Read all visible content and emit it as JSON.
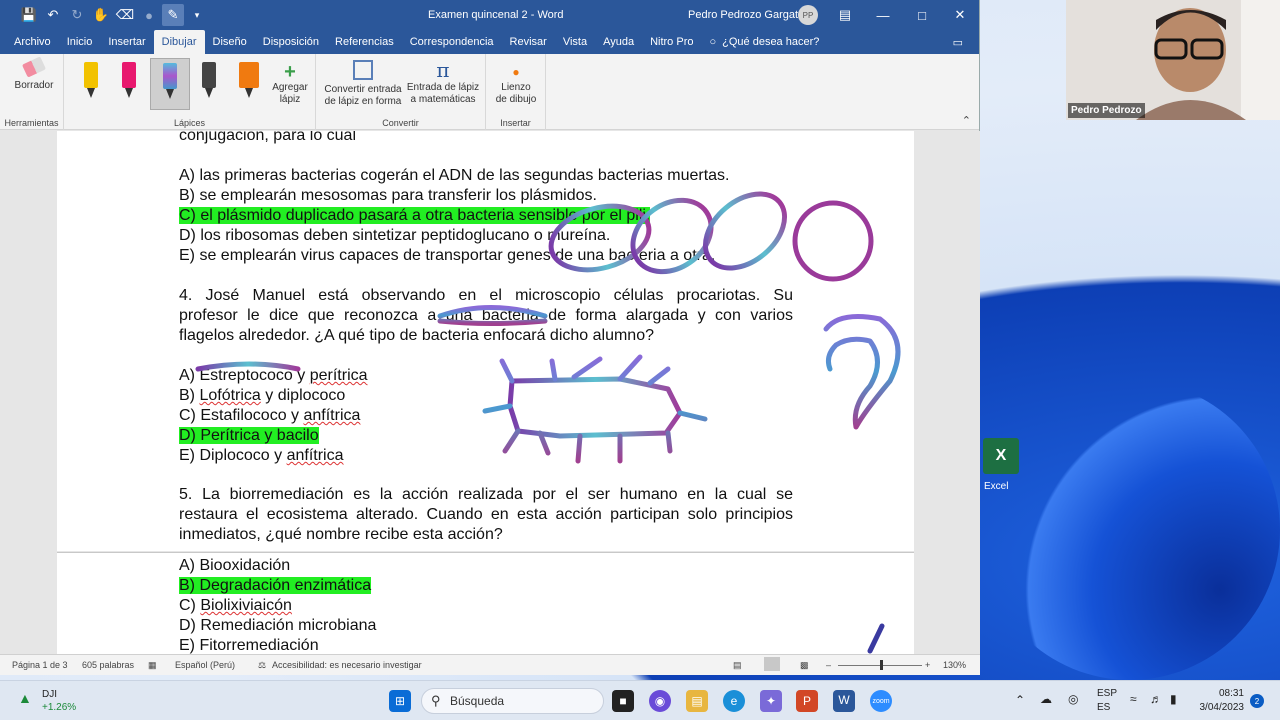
{
  "window": {
    "title": "Examen quincenal 2  -  Word",
    "user": "Pedro Pedrozo Gargate",
    "user_initials": "PP"
  },
  "menu": {
    "tabs": [
      "Archivo",
      "Inicio",
      "Insertar",
      "Dibujar",
      "Diseño",
      "Disposición",
      "Referencias",
      "Correspondencia",
      "Revisar",
      "Vista",
      "Ayuda",
      "Nitro Pro"
    ],
    "active": "Dibujar",
    "tell_me": "¿Qué desea hacer?"
  },
  "ribbon": {
    "eraser": "Borrador",
    "group_tools": "Herramientas",
    "add_pencil_1": "Agregar",
    "add_pencil_2": "lápiz",
    "group_pencils": "Lápices",
    "convert_1": "Convertir entrada",
    "convert_2": "de lápiz en forma",
    "math_1": "Entrada de lápiz",
    "math_2": "a matemáticas",
    "group_convert": "Convertir",
    "canvas_1": "Lienzo",
    "canvas_2": "de dibujo",
    "group_insert": "Insertar",
    "pen_colors": [
      "#f2c200",
      "#e8186e",
      "#6aa6d8",
      "#444444",
      "#f07a10"
    ]
  },
  "doc": {
    "l0": "conjugación, para lo cual",
    "q3a": "A) las primeras bacterias cogerán el ADN de las segundas bacterias muertas.",
    "q3b": "B) se emplearán mesosomas para transferir los plásmidos.",
    "q3c": "C) el plásmido duplicado pasará a otra bacteria sensible por el pili.",
    "q3d": "D) los ribosomas deben sintetizar peptidoglucano o mureína.",
    "q3e": "E) se emplearán virus capaces de transportar genes de una bacteria a otra.",
    "q4_l1": "4. José Manuel está observando en el microscopio células procariotas. Su",
    "q4_l2": "profesor le dice que reconozca a una bacteria de forma alargada y con varios",
    "q4_l3": "flagelos alrededor. ¿A qué tipo de bacteria enfocará dicho alumno?",
    "q4a_pre": "A) Estreptococo y ",
    "q4a_sq": "perítrica",
    "q4b_pre": "B) ",
    "q4b_sq": "Lofótrica",
    "q4b_post": " y diplococo",
    "q4c_pre": "C) Estafilococo y ",
    "q4c_sq": "anfítrica",
    "q4d": "D) Perítrica y bacilo",
    "q4e_pre": "E) Diplococo y ",
    "q4e_sq": "anfítrica",
    "q5_l1": "5. La biorremediación es la acción realizada por el ser humano en la cual se",
    "q5_l2": "restaura el ecosistema alterado. Cuando en esta acción participan solo principios",
    "q5_l3": "inmediatos, ¿qué nombre recibe esta acción?",
    "q5a": "A) Biooxidación",
    "q5b": "B) Degradación enzimática",
    "q5c_pre": "C) ",
    "q5c_sq": "Biolixiviaicón",
    "q5d": "D) Remediación microbiana",
    "q5e": "E) Fitorremediación"
  },
  "status": {
    "page": "Página 1 de 3",
    "words": "605 palabras",
    "language": "Español (Perú)",
    "accessibility": "Accesibilidad: es necesario investigar",
    "zoom": "130%"
  },
  "webcam": {
    "name": "Pedro Pedrozo"
  },
  "desktop": {
    "excel_label": "Excel"
  },
  "taskbar": {
    "stock_name": "DJI",
    "stock_change": "+1.26%",
    "search": "Búsqueda",
    "lang_1": "ESP",
    "lang_2": "ES",
    "time": "08:31",
    "date": "3/04/2023",
    "notifications": "2"
  },
  "colors": {
    "word_blue": "#2b579a",
    "highlight": "#22ee22"
  }
}
